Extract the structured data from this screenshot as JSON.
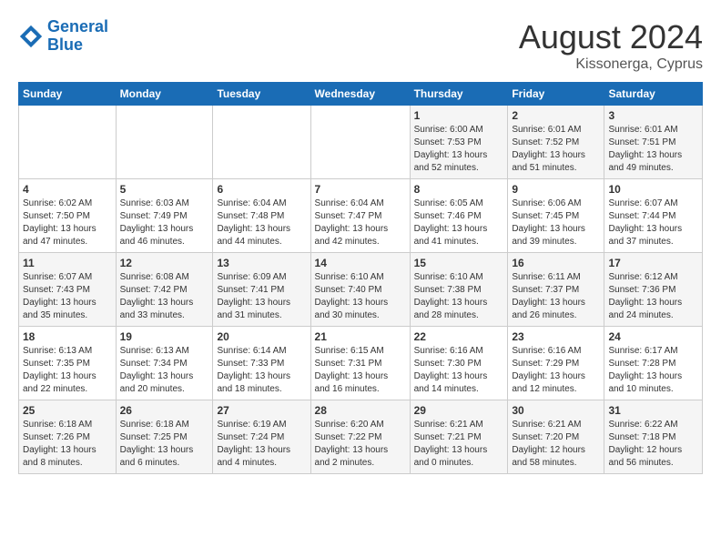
{
  "header": {
    "logo_line1": "General",
    "logo_line2": "Blue",
    "month_year": "August 2024",
    "location": "Kissonerga, Cyprus"
  },
  "days_of_week": [
    "Sunday",
    "Monday",
    "Tuesday",
    "Wednesday",
    "Thursday",
    "Friday",
    "Saturday"
  ],
  "weeks": [
    [
      {
        "day": "",
        "info": ""
      },
      {
        "day": "",
        "info": ""
      },
      {
        "day": "",
        "info": ""
      },
      {
        "day": "",
        "info": ""
      },
      {
        "day": "1",
        "info": "Sunrise: 6:00 AM\nSunset: 7:53 PM\nDaylight: 13 hours\nand 52 minutes."
      },
      {
        "day": "2",
        "info": "Sunrise: 6:01 AM\nSunset: 7:52 PM\nDaylight: 13 hours\nand 51 minutes."
      },
      {
        "day": "3",
        "info": "Sunrise: 6:01 AM\nSunset: 7:51 PM\nDaylight: 13 hours\nand 49 minutes."
      }
    ],
    [
      {
        "day": "4",
        "info": "Sunrise: 6:02 AM\nSunset: 7:50 PM\nDaylight: 13 hours\nand 47 minutes."
      },
      {
        "day": "5",
        "info": "Sunrise: 6:03 AM\nSunset: 7:49 PM\nDaylight: 13 hours\nand 46 minutes."
      },
      {
        "day": "6",
        "info": "Sunrise: 6:04 AM\nSunset: 7:48 PM\nDaylight: 13 hours\nand 44 minutes."
      },
      {
        "day": "7",
        "info": "Sunrise: 6:04 AM\nSunset: 7:47 PM\nDaylight: 13 hours\nand 42 minutes."
      },
      {
        "day": "8",
        "info": "Sunrise: 6:05 AM\nSunset: 7:46 PM\nDaylight: 13 hours\nand 41 minutes."
      },
      {
        "day": "9",
        "info": "Sunrise: 6:06 AM\nSunset: 7:45 PM\nDaylight: 13 hours\nand 39 minutes."
      },
      {
        "day": "10",
        "info": "Sunrise: 6:07 AM\nSunset: 7:44 PM\nDaylight: 13 hours\nand 37 minutes."
      }
    ],
    [
      {
        "day": "11",
        "info": "Sunrise: 6:07 AM\nSunset: 7:43 PM\nDaylight: 13 hours\nand 35 minutes."
      },
      {
        "day": "12",
        "info": "Sunrise: 6:08 AM\nSunset: 7:42 PM\nDaylight: 13 hours\nand 33 minutes."
      },
      {
        "day": "13",
        "info": "Sunrise: 6:09 AM\nSunset: 7:41 PM\nDaylight: 13 hours\nand 31 minutes."
      },
      {
        "day": "14",
        "info": "Sunrise: 6:10 AM\nSunset: 7:40 PM\nDaylight: 13 hours\nand 30 minutes."
      },
      {
        "day": "15",
        "info": "Sunrise: 6:10 AM\nSunset: 7:38 PM\nDaylight: 13 hours\nand 28 minutes."
      },
      {
        "day": "16",
        "info": "Sunrise: 6:11 AM\nSunset: 7:37 PM\nDaylight: 13 hours\nand 26 minutes."
      },
      {
        "day": "17",
        "info": "Sunrise: 6:12 AM\nSunset: 7:36 PM\nDaylight: 13 hours\nand 24 minutes."
      }
    ],
    [
      {
        "day": "18",
        "info": "Sunrise: 6:13 AM\nSunset: 7:35 PM\nDaylight: 13 hours\nand 22 minutes."
      },
      {
        "day": "19",
        "info": "Sunrise: 6:13 AM\nSunset: 7:34 PM\nDaylight: 13 hours\nand 20 minutes."
      },
      {
        "day": "20",
        "info": "Sunrise: 6:14 AM\nSunset: 7:33 PM\nDaylight: 13 hours\nand 18 minutes."
      },
      {
        "day": "21",
        "info": "Sunrise: 6:15 AM\nSunset: 7:31 PM\nDaylight: 13 hours\nand 16 minutes."
      },
      {
        "day": "22",
        "info": "Sunrise: 6:16 AM\nSunset: 7:30 PM\nDaylight: 13 hours\nand 14 minutes."
      },
      {
        "day": "23",
        "info": "Sunrise: 6:16 AM\nSunset: 7:29 PM\nDaylight: 13 hours\nand 12 minutes."
      },
      {
        "day": "24",
        "info": "Sunrise: 6:17 AM\nSunset: 7:28 PM\nDaylight: 13 hours\nand 10 minutes."
      }
    ],
    [
      {
        "day": "25",
        "info": "Sunrise: 6:18 AM\nSunset: 7:26 PM\nDaylight: 13 hours\nand 8 minutes."
      },
      {
        "day": "26",
        "info": "Sunrise: 6:18 AM\nSunset: 7:25 PM\nDaylight: 13 hours\nand 6 minutes."
      },
      {
        "day": "27",
        "info": "Sunrise: 6:19 AM\nSunset: 7:24 PM\nDaylight: 13 hours\nand 4 minutes."
      },
      {
        "day": "28",
        "info": "Sunrise: 6:20 AM\nSunset: 7:22 PM\nDaylight: 13 hours\nand 2 minutes."
      },
      {
        "day": "29",
        "info": "Sunrise: 6:21 AM\nSunset: 7:21 PM\nDaylight: 13 hours\nand 0 minutes."
      },
      {
        "day": "30",
        "info": "Sunrise: 6:21 AM\nSunset: 7:20 PM\nDaylight: 12 hours\nand 58 minutes."
      },
      {
        "day": "31",
        "info": "Sunrise: 6:22 AM\nSunset: 7:18 PM\nDaylight: 12 hours\nand 56 minutes."
      }
    ]
  ]
}
